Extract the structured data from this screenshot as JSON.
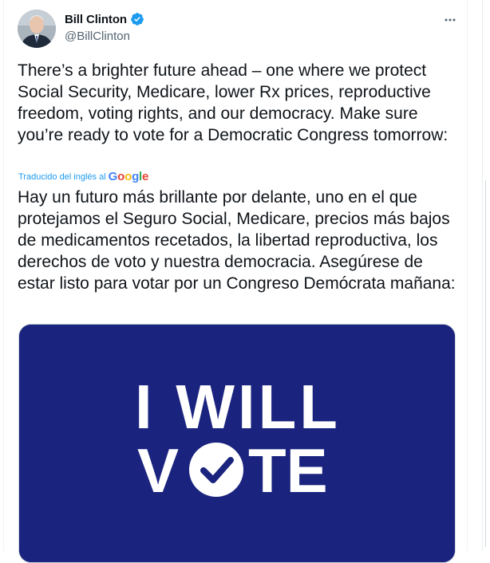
{
  "author": {
    "name": "Bill Clinton",
    "handle": "@BillClinton"
  },
  "tweet": {
    "text": "There’s a brighter future ahead – one where we protect Social Security, Medicare, lower Rx prices, reproductive freedom, voting rights, and our democracy. Make sure you’re ready to vote for a Democratic Congress tomorrow:",
    "translation_label": "Traducido del inglés al",
    "translation_provider": "Google",
    "translation_text": "Hay un futuro más brillante por delante, uno en el que protejamos el Seguro Social, Medicare, precios más bajos de medicamentos recetados, la libertad reproductiva, los derechos de voto y nuestra democracia. Asegúrese de estar listo para votar por un Congreso Demócrata mañana:"
  },
  "media": {
    "line1": "I WILL",
    "line2_part1": "V",
    "line2_part2": "TE"
  },
  "colors": {
    "accent": "#1d9bf0",
    "media_background": "#1a237e"
  },
  "icons": {
    "verified": "verified-badge-icon",
    "more": "more-options-icon",
    "vote_check": "check-circle-icon"
  }
}
